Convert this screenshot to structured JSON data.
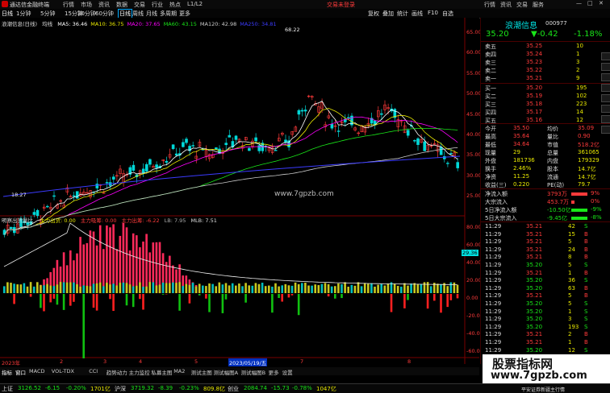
{
  "window": {
    "app_title": "通达信金融终端",
    "menus": [
      "行情",
      "市场",
      "资讯",
      "数据",
      "交易",
      "行业",
      "热点",
      "L1/L2"
    ],
    "trade_state": "交易未登录",
    "top_right": [
      "行情",
      "资讯",
      "交易",
      "服务"
    ]
  },
  "toolbar": {
    "periods": [
      "日线",
      "1分钟",
      "5分钟",
      "15分钟",
      "30分钟",
      "60分钟"
    ],
    "active_period": "日线",
    "options": [
      "日线",
      "周线",
      "月线",
      "多周期",
      "更多"
    ],
    "right_buttons": [
      "复权",
      "叠加",
      "统计",
      "画线",
      "F10",
      "自选"
    ]
  },
  "main_chart": {
    "stock_label": "浪潮信息(日线)",
    "ma_label": "均线",
    "ma": [
      {
        "name": "MA5",
        "value": "36.46",
        "color": "#ffffff"
      },
      {
        "name": "MA10",
        "value": "36.75",
        "color": "#e8e800"
      },
      {
        "name": "MA20",
        "value": "37.65",
        "color": "#ff00ff"
      },
      {
        "name": "MA60",
        "value": "43.15",
        "color": "#19e619"
      },
      {
        "name": "MA120",
        "value": "42.98",
        "color": "#cccccc"
      },
      {
        "name": "MA250",
        "value": "34.81",
        "color": "#3b3bff"
      }
    ],
    "high_mark": "68.22",
    "low_mark": "18.27",
    "watermark": "www.7gpzb.com",
    "price_axis": [
      "65.00",
      "60.00",
      "55.00",
      "50.00",
      "45.00",
      "40.00",
      "35.00",
      "30.00",
      "25.00"
    ],
    "price_axis_pct": [
      "71%",
      "57%",
      "43%",
      "28%",
      "14%",
      "0%",
      "14%",
      "28%"
    ]
  },
  "sub_chart": {
    "title": "明察出货量比",
    "items": [
      {
        "label": "主力出货",
        "value": "0.00",
        "color": "#e8e800"
      },
      {
        "label": "主力吸筹",
        "value": "0.00",
        "color": "#ff3b3b"
      },
      {
        "label": "主力出筹",
        "value": "-6.22",
        "color": "#ff3b3b"
      },
      {
        "label": "LB",
        "value": "7.95",
        "color": "#aaaaaa"
      },
      {
        "label": "MLB",
        "value": "7.51",
        "color": "#dddddd"
      }
    ],
    "axis": [
      "80.00",
      "60.00",
      "40.00",
      "20.00",
      "0.00",
      "-20.00",
      "-40.00",
      "-60.00"
    ],
    "cursor_value": "29.36"
  },
  "date_axis": {
    "labels": [
      "2023年",
      "2",
      "3",
      "4",
      "5",
      "2023/05/19/五",
      "7",
      "8"
    ]
  },
  "bottom_tabs": [
    "指标",
    "窗口",
    "MACD",
    "VOL-TDX",
    "CCI",
    "趋势动力",
    "主力监控",
    "私募主图",
    "MA2",
    "测试主图",
    "测试幅图A",
    "测试幅图B",
    "更多",
    "设置"
  ],
  "right_panel": {
    "stock_name": "浪潮信息",
    "stock_code": "000977",
    "price": "35.20",
    "change": "▼-0.42",
    "change_pct": "-1.18%",
    "asks": [
      {
        "label": "卖五",
        "price": "35.25",
        "vol": "10"
      },
      {
        "label": "卖四",
        "price": "35.24",
        "vol": "1"
      },
      {
        "label": "卖三",
        "price": "35.23",
        "vol": "3"
      },
      {
        "label": "卖二",
        "price": "35.22",
        "vol": "2"
      },
      {
        "label": "卖一",
        "price": "35.21",
        "vol": "9"
      }
    ],
    "bids": [
      {
        "label": "买一",
        "price": "35.20",
        "vol": "195"
      },
      {
        "label": "买二",
        "price": "35.19",
        "vol": "102"
      },
      {
        "label": "买三",
        "price": "35.18",
        "vol": "223"
      },
      {
        "label": "买四",
        "price": "35.17",
        "vol": "14"
      },
      {
        "label": "买五",
        "price": "35.16",
        "vol": "12"
      }
    ],
    "stats": [
      {
        "l1": "今开",
        "v1": "35.50",
        "l2": "均价",
        "v2": "35.09"
      },
      {
        "l1": "最高",
        "v1": "35.64",
        "l2": "量比",
        "v2": "0.90"
      },
      {
        "l1": "最低",
        "v1": "34.64",
        "l2": "市值",
        "v2": "518.2亿"
      },
      {
        "l1": "现量",
        "v1": "29",
        "l2": "总量",
        "v2": "361065"
      },
      {
        "l1": "外盘",
        "v1": "181736",
        "l2": "内盘",
        "v2": "179329"
      },
      {
        "l1": "换手",
        "v1": "2.46%",
        "l2": "股本",
        "v2": "14.7亿"
      },
      {
        "l1": "净资",
        "v1": "11.25",
        "l2": "流通",
        "v2": "14.7亿"
      },
      {
        "l1": "收益(三)",
        "v1": "0.220",
        "l2": "PE(动)",
        "v2": "79.7"
      }
    ],
    "flows": [
      {
        "label": "净流入额",
        "value": "3793万",
        "pct": "9%",
        "color": "#ff3b3b"
      },
      {
        "label": "大宗流入",
        "value": "453.7万",
        "pct": "0%",
        "color": "#ff3b3b"
      },
      {
        "label": "5日净流入额",
        "value": "-10.50亿",
        "pct": "-9%",
        "color": "#19e619"
      },
      {
        "label": "5日大宗流入",
        "value": "-9.45亿",
        "pct": "-8%",
        "color": "#19e619"
      }
    ],
    "ticks": [
      {
        "t": "11:29",
        "p": "35.21",
        "v": "42",
        "d": "S"
      },
      {
        "t": "11:29",
        "p": "35.21",
        "v": "15",
        "d": "B"
      },
      {
        "t": "11:29",
        "p": "35.21",
        "v": "5",
        "d": "B"
      },
      {
        "t": "11:29",
        "p": "35.21",
        "v": "24",
        "d": "B"
      },
      {
        "t": "11:29",
        "p": "35.21",
        "v": "8",
        "d": "B"
      },
      {
        "t": "11:29",
        "p": "35.20",
        "v": "5",
        "d": "S"
      },
      {
        "t": "11:29",
        "p": "35.21",
        "v": "1",
        "d": "B"
      },
      {
        "t": "11:29",
        "p": "35.20",
        "v": "36",
        "d": "S"
      },
      {
        "t": "11:29",
        "p": "35.20",
        "v": "63",
        "d": "B"
      },
      {
        "t": "11:29",
        "p": "35.21",
        "v": "5",
        "d": "B"
      },
      {
        "t": "11:29",
        "p": "35.20",
        "v": "5",
        "d": "S"
      },
      {
        "t": "11:29",
        "p": "35.20",
        "v": "1",
        "d": "S"
      },
      {
        "t": "11:29",
        "p": "35.20",
        "v": "3",
        "d": "S"
      },
      {
        "t": "11:29",
        "p": "35.20",
        "v": "193",
        "d": "S"
      },
      {
        "t": "11:29",
        "p": "35.21",
        "v": "2",
        "d": "B"
      },
      {
        "t": "11:29",
        "p": "35.21",
        "v": "1",
        "d": "B"
      },
      {
        "t": "11:29",
        "p": "35.20",
        "v": "12",
        "d": "S"
      },
      {
        "t": "11:29",
        "p": "35.20",
        "v": "5",
        "d": "S"
      }
    ]
  },
  "statusbar": {
    "items": [
      {
        "label": "上证",
        "value": "3126.52",
        "chg": "-6.15",
        "pct": "-0.20%",
        "amt": "1701亿"
      },
      {
        "label": "沪深",
        "value": "3719.32",
        "chg": "-8.39",
        "pct": "-0.23%",
        "amt": "809.8亿"
      },
      {
        "label": "创业",
        "value": "2084.74",
        "chg": "-15.73",
        "pct": "-0.78%",
        "amt": "1047亿"
      }
    ],
    "broker": "平安证券新疆主行情"
  },
  "banner": {
    "title": "股票指标网",
    "url": "www.7gpzb.com"
  }
}
